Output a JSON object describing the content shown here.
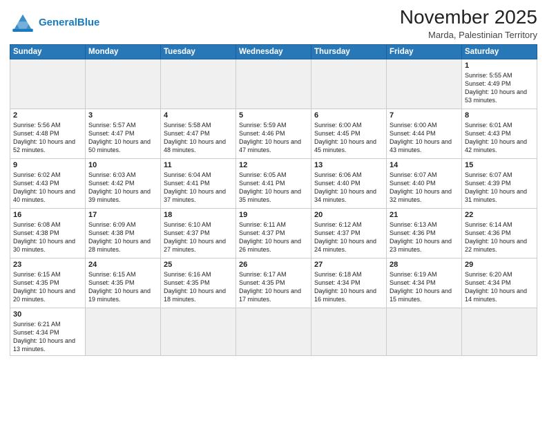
{
  "logo": {
    "text_general": "General",
    "text_blue": "Blue"
  },
  "title": "November 2025",
  "subtitle": "Marda, Palestinian Territory",
  "days_of_week": [
    "Sunday",
    "Monday",
    "Tuesday",
    "Wednesday",
    "Thursday",
    "Friday",
    "Saturday"
  ],
  "weeks": [
    [
      {
        "day": "",
        "info": "",
        "empty": true
      },
      {
        "day": "",
        "info": "",
        "empty": true
      },
      {
        "day": "",
        "info": "",
        "empty": true
      },
      {
        "day": "",
        "info": "",
        "empty": true
      },
      {
        "day": "",
        "info": "",
        "empty": true
      },
      {
        "day": "",
        "info": "",
        "empty": true
      },
      {
        "day": "1",
        "info": "Sunrise: 5:55 AM\nSunset: 4:49 PM\nDaylight: 10 hours\nand 53 minutes.",
        "empty": false
      }
    ],
    [
      {
        "day": "2",
        "info": "Sunrise: 5:56 AM\nSunset: 4:48 PM\nDaylight: 10 hours\nand 52 minutes.",
        "empty": false
      },
      {
        "day": "3",
        "info": "Sunrise: 5:57 AM\nSunset: 4:47 PM\nDaylight: 10 hours\nand 50 minutes.",
        "empty": false
      },
      {
        "day": "4",
        "info": "Sunrise: 5:58 AM\nSunset: 4:47 PM\nDaylight: 10 hours\nand 48 minutes.",
        "empty": false
      },
      {
        "day": "5",
        "info": "Sunrise: 5:59 AM\nSunset: 4:46 PM\nDaylight: 10 hours\nand 47 minutes.",
        "empty": false
      },
      {
        "day": "6",
        "info": "Sunrise: 6:00 AM\nSunset: 4:45 PM\nDaylight: 10 hours\nand 45 minutes.",
        "empty": false
      },
      {
        "day": "7",
        "info": "Sunrise: 6:00 AM\nSunset: 4:44 PM\nDaylight: 10 hours\nand 43 minutes.",
        "empty": false
      },
      {
        "day": "8",
        "info": "Sunrise: 6:01 AM\nSunset: 4:43 PM\nDaylight: 10 hours\nand 42 minutes.",
        "empty": false
      }
    ],
    [
      {
        "day": "9",
        "info": "Sunrise: 6:02 AM\nSunset: 4:43 PM\nDaylight: 10 hours\nand 40 minutes.",
        "empty": false
      },
      {
        "day": "10",
        "info": "Sunrise: 6:03 AM\nSunset: 4:42 PM\nDaylight: 10 hours\nand 39 minutes.",
        "empty": false
      },
      {
        "day": "11",
        "info": "Sunrise: 6:04 AM\nSunset: 4:41 PM\nDaylight: 10 hours\nand 37 minutes.",
        "empty": false
      },
      {
        "day": "12",
        "info": "Sunrise: 6:05 AM\nSunset: 4:41 PM\nDaylight: 10 hours\nand 35 minutes.",
        "empty": false
      },
      {
        "day": "13",
        "info": "Sunrise: 6:06 AM\nSunset: 4:40 PM\nDaylight: 10 hours\nand 34 minutes.",
        "empty": false
      },
      {
        "day": "14",
        "info": "Sunrise: 6:07 AM\nSunset: 4:40 PM\nDaylight: 10 hours\nand 32 minutes.",
        "empty": false
      },
      {
        "day": "15",
        "info": "Sunrise: 6:07 AM\nSunset: 4:39 PM\nDaylight: 10 hours\nand 31 minutes.",
        "empty": false
      }
    ],
    [
      {
        "day": "16",
        "info": "Sunrise: 6:08 AM\nSunset: 4:38 PM\nDaylight: 10 hours\nand 30 minutes.",
        "empty": false
      },
      {
        "day": "17",
        "info": "Sunrise: 6:09 AM\nSunset: 4:38 PM\nDaylight: 10 hours\nand 28 minutes.",
        "empty": false
      },
      {
        "day": "18",
        "info": "Sunrise: 6:10 AM\nSunset: 4:37 PM\nDaylight: 10 hours\nand 27 minutes.",
        "empty": false
      },
      {
        "day": "19",
        "info": "Sunrise: 6:11 AM\nSunset: 4:37 PM\nDaylight: 10 hours\nand 26 minutes.",
        "empty": false
      },
      {
        "day": "20",
        "info": "Sunrise: 6:12 AM\nSunset: 4:37 PM\nDaylight: 10 hours\nand 24 minutes.",
        "empty": false
      },
      {
        "day": "21",
        "info": "Sunrise: 6:13 AM\nSunset: 4:36 PM\nDaylight: 10 hours\nand 23 minutes.",
        "empty": false
      },
      {
        "day": "22",
        "info": "Sunrise: 6:14 AM\nSunset: 4:36 PM\nDaylight: 10 hours\nand 22 minutes.",
        "empty": false
      }
    ],
    [
      {
        "day": "23",
        "info": "Sunrise: 6:15 AM\nSunset: 4:35 PM\nDaylight: 10 hours\nand 20 minutes.",
        "empty": false
      },
      {
        "day": "24",
        "info": "Sunrise: 6:15 AM\nSunset: 4:35 PM\nDaylight: 10 hours\nand 19 minutes.",
        "empty": false
      },
      {
        "day": "25",
        "info": "Sunrise: 6:16 AM\nSunset: 4:35 PM\nDaylight: 10 hours\nand 18 minutes.",
        "empty": false
      },
      {
        "day": "26",
        "info": "Sunrise: 6:17 AM\nSunset: 4:35 PM\nDaylight: 10 hours\nand 17 minutes.",
        "empty": false
      },
      {
        "day": "27",
        "info": "Sunrise: 6:18 AM\nSunset: 4:34 PM\nDaylight: 10 hours\nand 16 minutes.",
        "empty": false
      },
      {
        "day": "28",
        "info": "Sunrise: 6:19 AM\nSunset: 4:34 PM\nDaylight: 10 hours\nand 15 minutes.",
        "empty": false
      },
      {
        "day": "29",
        "info": "Sunrise: 6:20 AM\nSunset: 4:34 PM\nDaylight: 10 hours\nand 14 minutes.",
        "empty": false
      }
    ],
    [
      {
        "day": "30",
        "info": "Sunrise: 6:21 AM\nSunset: 4:34 PM\nDaylight: 10 hours\nand 13 minutes.",
        "empty": false
      },
      {
        "day": "",
        "info": "",
        "empty": true
      },
      {
        "day": "",
        "info": "",
        "empty": true
      },
      {
        "day": "",
        "info": "",
        "empty": true
      },
      {
        "day": "",
        "info": "",
        "empty": true
      },
      {
        "day": "",
        "info": "",
        "empty": true
      },
      {
        "day": "",
        "info": "",
        "empty": true
      }
    ]
  ]
}
